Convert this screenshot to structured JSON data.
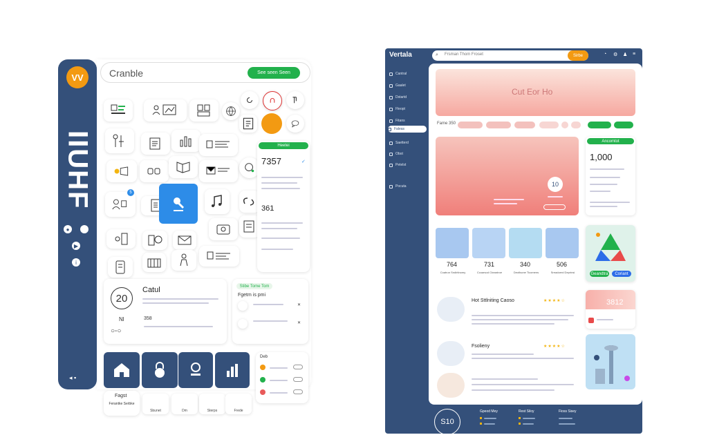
{
  "left": {
    "logo": "VV",
    "vertical_title": "IIUHF",
    "search": {
      "text": "Cranble",
      "button": "See seen Seen"
    },
    "stat_card": {
      "title": "Heetei",
      "value1": "7357",
      "value2": "361"
    },
    "feature_card": {
      "number": "20",
      "title": "Catul",
      "sub": "Nl",
      "value": "358"
    },
    "list_card": {
      "pill": "Stibe Tome Tom",
      "heading": "Fgetm is pmi"
    },
    "bottom_card": {
      "title": "Deb"
    },
    "small_tiles": [
      {
        "label": "Fagst",
        "sub": "Ferantke Serbke"
      },
      {
        "label": "Sbunet"
      },
      {
        "label": "Dm"
      },
      {
        "label": "Sterps"
      },
      {
        "label": "Frede"
      }
    ]
  },
  "right": {
    "logo": "Vertala",
    "search": {
      "placeholder": "Frsman Thom Froset",
      "button": "Sirbe"
    },
    "nav": [
      "Cantral",
      "Gaalet",
      "Dstartd",
      "Fleopt",
      "Fitans",
      "Faleas",
      "Saetterd",
      "Obot",
      "Petelst",
      "Pocuta"
    ],
    "hero_text": "Cut Eor Ho",
    "filter_label": "Fame 350",
    "hero_badge": "10",
    "stat_card": {
      "pill": "Ancomtot",
      "value": "1,000"
    },
    "tiles": [
      {
        "value": "764",
        "label": "Coatrun Sndirtinomy"
      },
      {
        "value": "731",
        "label": "Ccoarsod Ctowstroe"
      },
      {
        "value": "340",
        "label": "Deotlsone Ticomens"
      },
      {
        "value": "506",
        "label": "Sreadoerd Deprinsi"
      }
    ],
    "chart_buttons": [
      "Geandtra",
      "Coriant"
    ],
    "articles": [
      {
        "title": "Hot Sttlniting Caoso",
        "stars": "★★★★☆"
      },
      {
        "title": "Fsolieny",
        "stars": "★★★★☆"
      },
      {
        "title": "",
        "stars": ""
      }
    ],
    "promo": {
      "value": "3812"
    },
    "footer": {
      "badge": "S10",
      "cols": [
        "Gpeod Mey",
        "Rest Siloy",
        "Fioss Sisey"
      ]
    }
  }
}
